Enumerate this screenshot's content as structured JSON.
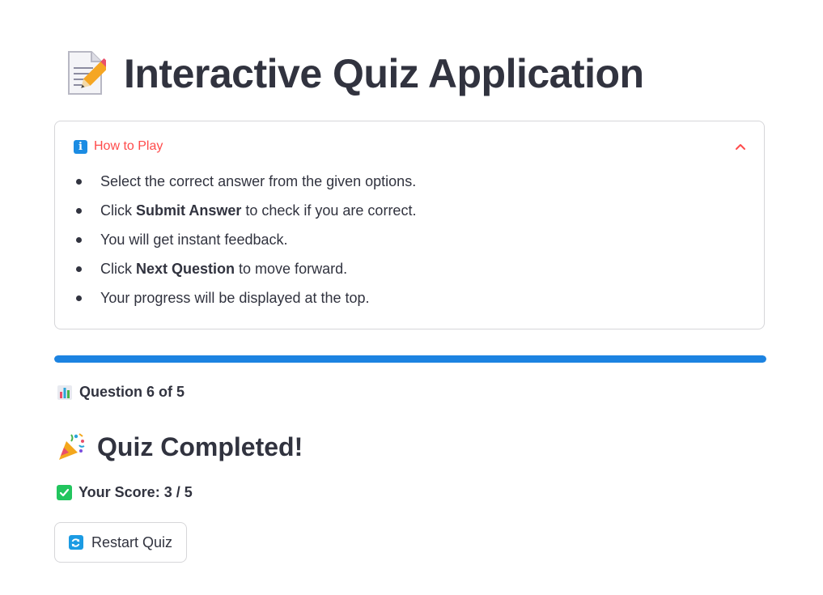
{
  "header": {
    "title_icon": "memo-pencil-icon",
    "title": "Interactive Quiz Application"
  },
  "how_to_play": {
    "icon": "info-icon",
    "title": "How to Play",
    "expanded": true,
    "accent_color": "#ff4b4b",
    "items": [
      {
        "before": "Select the correct answer from the given options.",
        "bold": "",
        "after": ""
      },
      {
        "before": "Click ",
        "bold": "Submit Answer",
        "after": " to check if you are correct."
      },
      {
        "before": "You will get instant feedback.",
        "bold": "",
        "after": ""
      },
      {
        "before": "Click ",
        "bold": "Next Question",
        "after": " to move forward."
      },
      {
        "before": "Your progress will be displayed at the top.",
        "bold": "",
        "after": ""
      }
    ]
  },
  "progress": {
    "fraction": 1.0,
    "color": "#1c83e1",
    "icon": "bar-chart-icon",
    "label": "Question 6 of 5"
  },
  "result": {
    "icon": "party-popper-icon",
    "title": "Quiz Completed!",
    "score_icon": "check-mark-icon",
    "score_label": "Your Score: 3 / 5"
  },
  "restart": {
    "icon": "refresh-icon",
    "label": "Restart Quiz"
  }
}
